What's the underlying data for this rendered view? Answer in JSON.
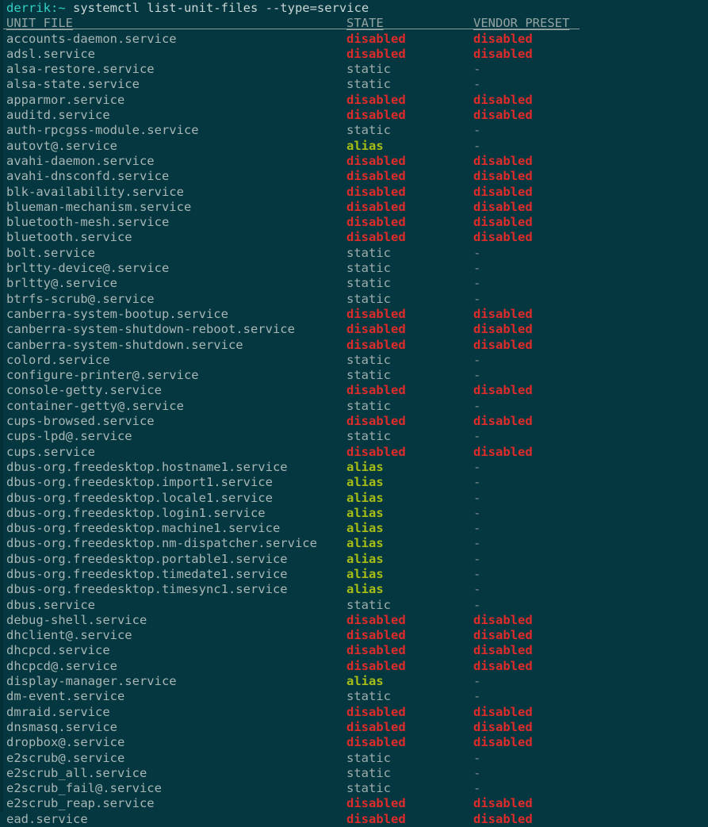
{
  "terminal": {
    "background_color": "#04373f",
    "default_text_color": "#a7b4b4",
    "prompt": {
      "user_host": "derrik:~",
      "user_host_color": "#34cfc4",
      "command": " systemctl list-unit-files --type=service",
      "command_color": "#c9d5d5"
    }
  },
  "table": {
    "headers": {
      "unit_file": "UNIT FILE",
      "state": "STATE",
      "vendor_preset": "VENDOR PRESET"
    },
    "state_colors": {
      "disabled": "#e02b2b",
      "alias": "#a8bd15",
      "static": "#9fadad",
      "dash": "#7d8c8c"
    },
    "dash": "-",
    "rows": [
      {
        "unit": "accounts-daemon.service",
        "state": "disabled",
        "preset": "disabled"
      },
      {
        "unit": "adsl.service",
        "state": "disabled",
        "preset": "disabled"
      },
      {
        "unit": "alsa-restore.service",
        "state": "static",
        "preset": "-"
      },
      {
        "unit": "alsa-state.service",
        "state": "static",
        "preset": "-"
      },
      {
        "unit": "apparmor.service",
        "state": "disabled",
        "preset": "disabled"
      },
      {
        "unit": "auditd.service",
        "state": "disabled",
        "preset": "disabled"
      },
      {
        "unit": "auth-rpcgss-module.service",
        "state": "static",
        "preset": "-"
      },
      {
        "unit": "autovt@.service",
        "state": "alias",
        "preset": "-"
      },
      {
        "unit": "avahi-daemon.service",
        "state": "disabled",
        "preset": "disabled"
      },
      {
        "unit": "avahi-dnsconfd.service",
        "state": "disabled",
        "preset": "disabled"
      },
      {
        "unit": "blk-availability.service",
        "state": "disabled",
        "preset": "disabled"
      },
      {
        "unit": "blueman-mechanism.service",
        "state": "disabled",
        "preset": "disabled"
      },
      {
        "unit": "bluetooth-mesh.service",
        "state": "disabled",
        "preset": "disabled"
      },
      {
        "unit": "bluetooth.service",
        "state": "disabled",
        "preset": "disabled"
      },
      {
        "unit": "bolt.service",
        "state": "static",
        "preset": "-"
      },
      {
        "unit": "brltty-device@.service",
        "state": "static",
        "preset": "-"
      },
      {
        "unit": "brltty@.service",
        "state": "static",
        "preset": "-"
      },
      {
        "unit": "btrfs-scrub@.service",
        "state": "static",
        "preset": "-"
      },
      {
        "unit": "canberra-system-bootup.service",
        "state": "disabled",
        "preset": "disabled"
      },
      {
        "unit": "canberra-system-shutdown-reboot.service",
        "state": "disabled",
        "preset": "disabled"
      },
      {
        "unit": "canberra-system-shutdown.service",
        "state": "disabled",
        "preset": "disabled"
      },
      {
        "unit": "colord.service",
        "state": "static",
        "preset": "-"
      },
      {
        "unit": "configure-printer@.service",
        "state": "static",
        "preset": "-"
      },
      {
        "unit": "console-getty.service",
        "state": "disabled",
        "preset": "disabled"
      },
      {
        "unit": "container-getty@.service",
        "state": "static",
        "preset": "-"
      },
      {
        "unit": "cups-browsed.service",
        "state": "disabled",
        "preset": "disabled"
      },
      {
        "unit": "cups-lpd@.service",
        "state": "static",
        "preset": "-"
      },
      {
        "unit": "cups.service",
        "state": "disabled",
        "preset": "disabled"
      },
      {
        "unit": "dbus-org.freedesktop.hostname1.service",
        "state": "alias",
        "preset": "-"
      },
      {
        "unit": "dbus-org.freedesktop.import1.service",
        "state": "alias",
        "preset": "-"
      },
      {
        "unit": "dbus-org.freedesktop.locale1.service",
        "state": "alias",
        "preset": "-"
      },
      {
        "unit": "dbus-org.freedesktop.login1.service",
        "state": "alias",
        "preset": "-"
      },
      {
        "unit": "dbus-org.freedesktop.machine1.service",
        "state": "alias",
        "preset": "-"
      },
      {
        "unit": "dbus-org.freedesktop.nm-dispatcher.service",
        "state": "alias",
        "preset": "-"
      },
      {
        "unit": "dbus-org.freedesktop.portable1.service",
        "state": "alias",
        "preset": "-"
      },
      {
        "unit": "dbus-org.freedesktop.timedate1.service",
        "state": "alias",
        "preset": "-"
      },
      {
        "unit": "dbus-org.freedesktop.timesync1.service",
        "state": "alias",
        "preset": "-"
      },
      {
        "unit": "dbus.service",
        "state": "static",
        "preset": "-"
      },
      {
        "unit": "debug-shell.service",
        "state": "disabled",
        "preset": "disabled"
      },
      {
        "unit": "dhclient@.service",
        "state": "disabled",
        "preset": "disabled"
      },
      {
        "unit": "dhcpcd.service",
        "state": "disabled",
        "preset": "disabled"
      },
      {
        "unit": "dhcpcd@.service",
        "state": "disabled",
        "preset": "disabled"
      },
      {
        "unit": "display-manager.service",
        "state": "alias",
        "preset": "-"
      },
      {
        "unit": "dm-event.service",
        "state": "static",
        "preset": "-"
      },
      {
        "unit": "dmraid.service",
        "state": "disabled",
        "preset": "disabled"
      },
      {
        "unit": "dnsmasq.service",
        "state": "disabled",
        "preset": "disabled"
      },
      {
        "unit": "dropbox@.service",
        "state": "disabled",
        "preset": "disabled"
      },
      {
        "unit": "e2scrub@.service",
        "state": "static",
        "preset": "-"
      },
      {
        "unit": "e2scrub_all.service",
        "state": "static",
        "preset": "-"
      },
      {
        "unit": "e2scrub_fail@.service",
        "state": "static",
        "preset": "-"
      },
      {
        "unit": "e2scrub_reap.service",
        "state": "disabled",
        "preset": "disabled"
      },
      {
        "unit": "ead.service",
        "state": "disabled",
        "preset": "disabled"
      }
    ]
  }
}
